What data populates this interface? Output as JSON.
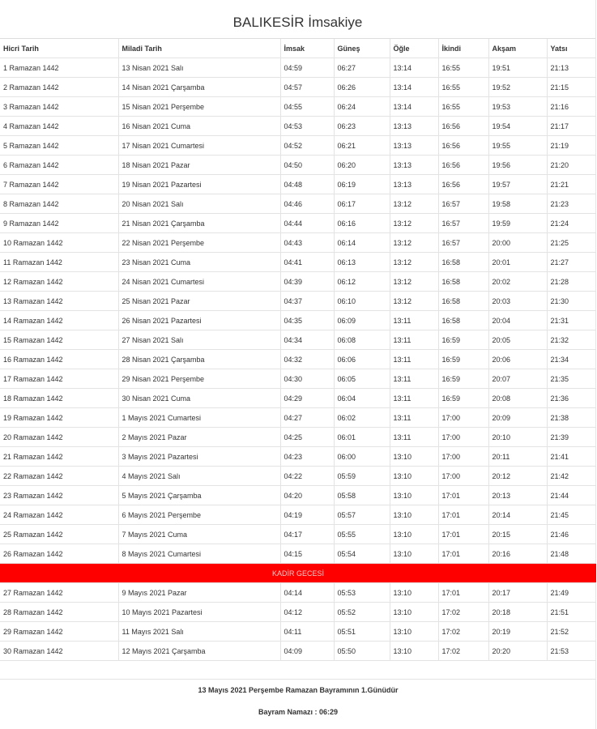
{
  "title": "BALIKESİR İmsakiye",
  "headers": [
    "Hicri Tarih",
    "Miladi Tarih",
    "İmsak",
    "Güneş",
    "Öğle",
    "İkindi",
    "Akşam",
    "Yatsı"
  ],
  "rows_before": [
    [
      "1 Ramazan 1442",
      "13 Nisan 2021 Salı",
      "04:59",
      "06:27",
      "13:14",
      "16:55",
      "19:51",
      "21:13"
    ],
    [
      "2 Ramazan 1442",
      "14 Nisan 2021 Çarşamba",
      "04:57",
      "06:26",
      "13:14",
      "16:55",
      "19:52",
      "21:15"
    ],
    [
      "3 Ramazan 1442",
      "15 Nisan 2021 Perşembe",
      "04:55",
      "06:24",
      "13:14",
      "16:55",
      "19:53",
      "21:16"
    ],
    [
      "4 Ramazan 1442",
      "16 Nisan 2021 Cuma",
      "04:53",
      "06:23",
      "13:13",
      "16:56",
      "19:54",
      "21:17"
    ],
    [
      "5 Ramazan 1442",
      "17 Nisan 2021 Cumartesi",
      "04:52",
      "06:21",
      "13:13",
      "16:56",
      "19:55",
      "21:19"
    ],
    [
      "6 Ramazan 1442",
      "18 Nisan 2021 Pazar",
      "04:50",
      "06:20",
      "13:13",
      "16:56",
      "19:56",
      "21:20"
    ],
    [
      "7 Ramazan 1442",
      "19 Nisan 2021 Pazartesi",
      "04:48",
      "06:19",
      "13:13",
      "16:56",
      "19:57",
      "21:21"
    ],
    [
      "8 Ramazan 1442",
      "20 Nisan 2021 Salı",
      "04:46",
      "06:17",
      "13:12",
      "16:57",
      "19:58",
      "21:23"
    ],
    [
      "9 Ramazan 1442",
      "21 Nisan 2021 Çarşamba",
      "04:44",
      "06:16",
      "13:12",
      "16:57",
      "19:59",
      "21:24"
    ],
    [
      "10 Ramazan 1442",
      "22 Nisan 2021 Perşembe",
      "04:43",
      "06:14",
      "13:12",
      "16:57",
      "20:00",
      "21:25"
    ],
    [
      "11 Ramazan 1442",
      "23 Nisan 2021 Cuma",
      "04:41",
      "06:13",
      "13:12",
      "16:58",
      "20:01",
      "21:27"
    ],
    [
      "12 Ramazan 1442",
      "24 Nisan 2021 Cumartesi",
      "04:39",
      "06:12",
      "13:12",
      "16:58",
      "20:02",
      "21:28"
    ],
    [
      "13 Ramazan 1442",
      "25 Nisan 2021 Pazar",
      "04:37",
      "06:10",
      "13:12",
      "16:58",
      "20:03",
      "21:30"
    ],
    [
      "14 Ramazan 1442",
      "26 Nisan 2021 Pazartesi",
      "04:35",
      "06:09",
      "13:11",
      "16:58",
      "20:04",
      "21:31"
    ],
    [
      "15 Ramazan 1442",
      "27 Nisan 2021 Salı",
      "04:34",
      "06:08",
      "13:11",
      "16:59",
      "20:05",
      "21:32"
    ],
    [
      "16 Ramazan 1442",
      "28 Nisan 2021 Çarşamba",
      "04:32",
      "06:06",
      "13:11",
      "16:59",
      "20:06",
      "21:34"
    ],
    [
      "17 Ramazan 1442",
      "29 Nisan 2021 Perşembe",
      "04:30",
      "06:05",
      "13:11",
      "16:59",
      "20:07",
      "21:35"
    ],
    [
      "18 Ramazan 1442",
      "30 Nisan 2021 Cuma",
      "04:29",
      "06:04",
      "13:11",
      "16:59",
      "20:08",
      "21:36"
    ],
    [
      "19 Ramazan 1442",
      "1 Mayıs 2021 Cumartesi",
      "04:27",
      "06:02",
      "13:11",
      "17:00",
      "20:09",
      "21:38"
    ],
    [
      "20 Ramazan 1442",
      "2 Mayıs 2021 Pazar",
      "04:25",
      "06:01",
      "13:11",
      "17:00",
      "20:10",
      "21:39"
    ],
    [
      "21 Ramazan 1442",
      "3 Mayıs 2021 Pazartesi",
      "04:23",
      "06:00",
      "13:10",
      "17:00",
      "20:11",
      "21:41"
    ],
    [
      "22 Ramazan 1442",
      "4 Mayıs 2021 Salı",
      "04:22",
      "05:59",
      "13:10",
      "17:00",
      "20:12",
      "21:42"
    ],
    [
      "23 Ramazan 1442",
      "5 Mayıs 2021 Çarşamba",
      "04:20",
      "05:58",
      "13:10",
      "17:01",
      "20:13",
      "21:44"
    ],
    [
      "24 Ramazan 1442",
      "6 Mayıs 2021 Perşembe",
      "04:19",
      "05:57",
      "13:10",
      "17:01",
      "20:14",
      "21:45"
    ],
    [
      "25 Ramazan 1442",
      "7 Mayıs 2021 Cuma",
      "04:17",
      "05:55",
      "13:10",
      "17:01",
      "20:15",
      "21:46"
    ],
    [
      "26 Ramazan 1442",
      "8 Mayıs 2021 Cumartesi",
      "04:15",
      "05:54",
      "13:10",
      "17:01",
      "20:16",
      "21:48"
    ]
  ],
  "special_label": "KADİR GECESİ",
  "special_color": "#ff0000",
  "rows_after": [
    [
      "27 Ramazan 1442",
      "9 Mayıs 2021 Pazar",
      "04:14",
      "05:53",
      "13:10",
      "17:01",
      "20:17",
      "21:49"
    ],
    [
      "28 Ramazan 1442",
      "10 Mayıs 2021 Pazartesi",
      "04:12",
      "05:52",
      "13:10",
      "17:02",
      "20:18",
      "21:51"
    ],
    [
      "29 Ramazan 1442",
      "11 Mayıs 2021 Salı",
      "04:11",
      "05:51",
      "13:10",
      "17:02",
      "20:19",
      "21:52"
    ],
    [
      "30 Ramazan 1442",
      "12 Mayıs 2021 Çarşamba",
      "04:09",
      "05:50",
      "13:10",
      "17:02",
      "20:20",
      "21:53"
    ]
  ],
  "footer": {
    "bayram_note": "13 Mayıs 2021 Perşembe Ramazan Bayramının 1.Günüdür",
    "bayram_namazi": "Bayram Namazı : 06:29"
  }
}
